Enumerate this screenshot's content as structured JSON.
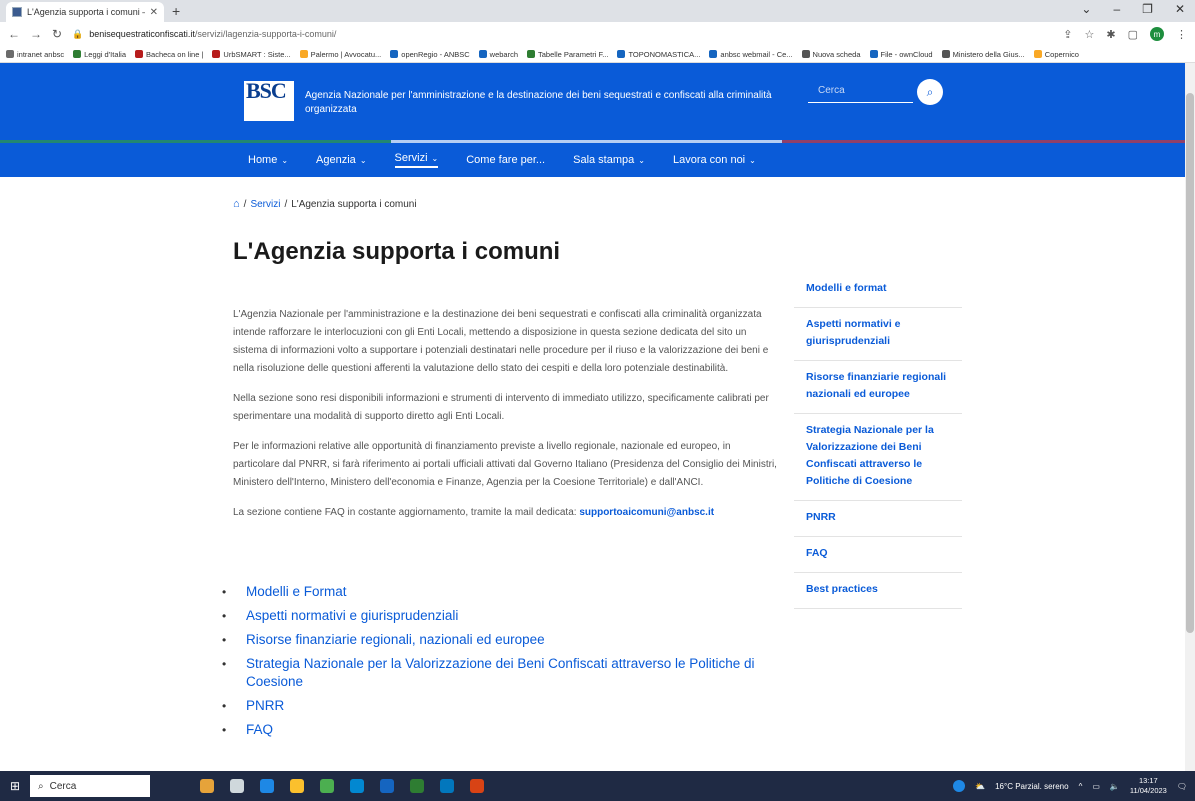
{
  "browser": {
    "tab_title": "L'Agenzia supporta i comuni – A",
    "tab_close": "✕",
    "new_tab": "+",
    "url_host": "benisequestraticonfiscati.it",
    "url_path": "/servizi/lagenzia-supporta-i-comuni/",
    "bookmarks": [
      {
        "label": "intranet anbsc",
        "color": "#6b6b6b"
      },
      {
        "label": "Leggi d'Italia",
        "color": "#2e7d32"
      },
      {
        "label": "Bacheca on line |",
        "color": "#b71c1c"
      },
      {
        "label": "UrbSMART : Siste...",
        "color": "#b71c1c"
      },
      {
        "label": "Palermo | Avvocatu...",
        "color": "#f9a825"
      },
      {
        "label": "openRegio - ANBSC",
        "color": "#1565c0"
      },
      {
        "label": "webarch",
        "color": "#1565c0"
      },
      {
        "label": "Tabelle Parametri F...",
        "color": "#2e7d32"
      },
      {
        "label": "TOPONOMASTICA...",
        "color": "#1565c0"
      },
      {
        "label": "anbsc webmail - Ce...",
        "color": "#1565c0"
      },
      {
        "label": "Nuova scheda",
        "color": "#555555"
      },
      {
        "label": "File - ownCloud",
        "color": "#1565c0"
      },
      {
        "label": "Ministero della Gius...",
        "color": "#555555"
      },
      {
        "label": "Copernico",
        "color": "#f9a825"
      }
    ]
  },
  "header": {
    "logo_text": "BSC",
    "agency_name": "Agenzia Nazionale per l'amministrazione e la destinazione dei beni sequestrati e confiscati alla criminalità organizzata",
    "search_placeholder": "Cerca"
  },
  "nav": [
    {
      "label": "Home",
      "dropdown": true
    },
    {
      "label": "Agenzia",
      "dropdown": true
    },
    {
      "label": "Servizi",
      "dropdown": true,
      "active": true
    },
    {
      "label": "Come fare per...",
      "dropdown": false
    },
    {
      "label": "Sala stampa",
      "dropdown": true
    },
    {
      "label": "Lavora con noi",
      "dropdown": true
    }
  ],
  "breadcrumb": {
    "sep": "/",
    "servizi": "Servizi",
    "current": "L'Agenzia supporta i comuni"
  },
  "page": {
    "title": "L'Agenzia supporta i comuni",
    "paragraphs": [
      "L'Agenzia Nazionale per l'amministrazione e la destinazione dei beni sequestrati e confiscati alla criminalità organizzata intende rafforzare le interlocuzioni con gli Enti Locali, mettendo a disposizione in questa sezione dedicata del sito un sistema di informazioni volto a supportare i potenziali destinatari nelle procedure per il riuso e la valorizzazione dei beni e nella risoluzione delle questioni afferenti la valutazione dello stato dei cespiti e della loro potenziale destinabilità.",
      "Nella sezione sono resi disponibili informazioni e strumenti di intervento di immediato utilizzo, specificamente calibrati per sperimentare una modalità di supporto diretto agli Enti Locali.",
      "Per le informazioni relative alle opportunità di finanziamento previste a livello regionale, nazionale ed europeo, in particolare dal PNRR, si farà riferimento ai portali ufficiali attivati dal Governo Italiano (Presidenza del Consiglio dei Ministri, Ministero dell'Interno, Ministero dell'economia e Finanze, Agenzia per la Coesione Territoriale) e dall'ANCI."
    ],
    "faq_text": "La sezione contiene FAQ in costante aggiornamento, tramite la mail dedicata:",
    "faq_email": "supportoaicomuni@anbsc.it",
    "bullet": "•",
    "links": [
      "Modelli e Format",
      "Aspetti normativi e giurisprudenziali",
      "Risorse finanziarie regionali, nazionali ed europee",
      "Strategia Nazionale per la Valorizzazione dei Beni Confiscati attraverso le Politiche di Coesione",
      "PNRR",
      "FAQ"
    ]
  },
  "sidebar": [
    "Modelli e format",
    "Aspetti normativi e giurisprudenziali",
    "Risorse finanziarie regionali nazionali ed europee",
    "Strategia Nazionale per la Valorizzazione dei Beni Confiscati attraverso le Politiche di Coesione",
    "PNRR",
    "FAQ",
    "Best practices"
  ],
  "taskbar": {
    "search_label": "Cerca",
    "weather": "16°C Parzial. sereno",
    "time": "13:17",
    "date": "11/04/2023"
  }
}
